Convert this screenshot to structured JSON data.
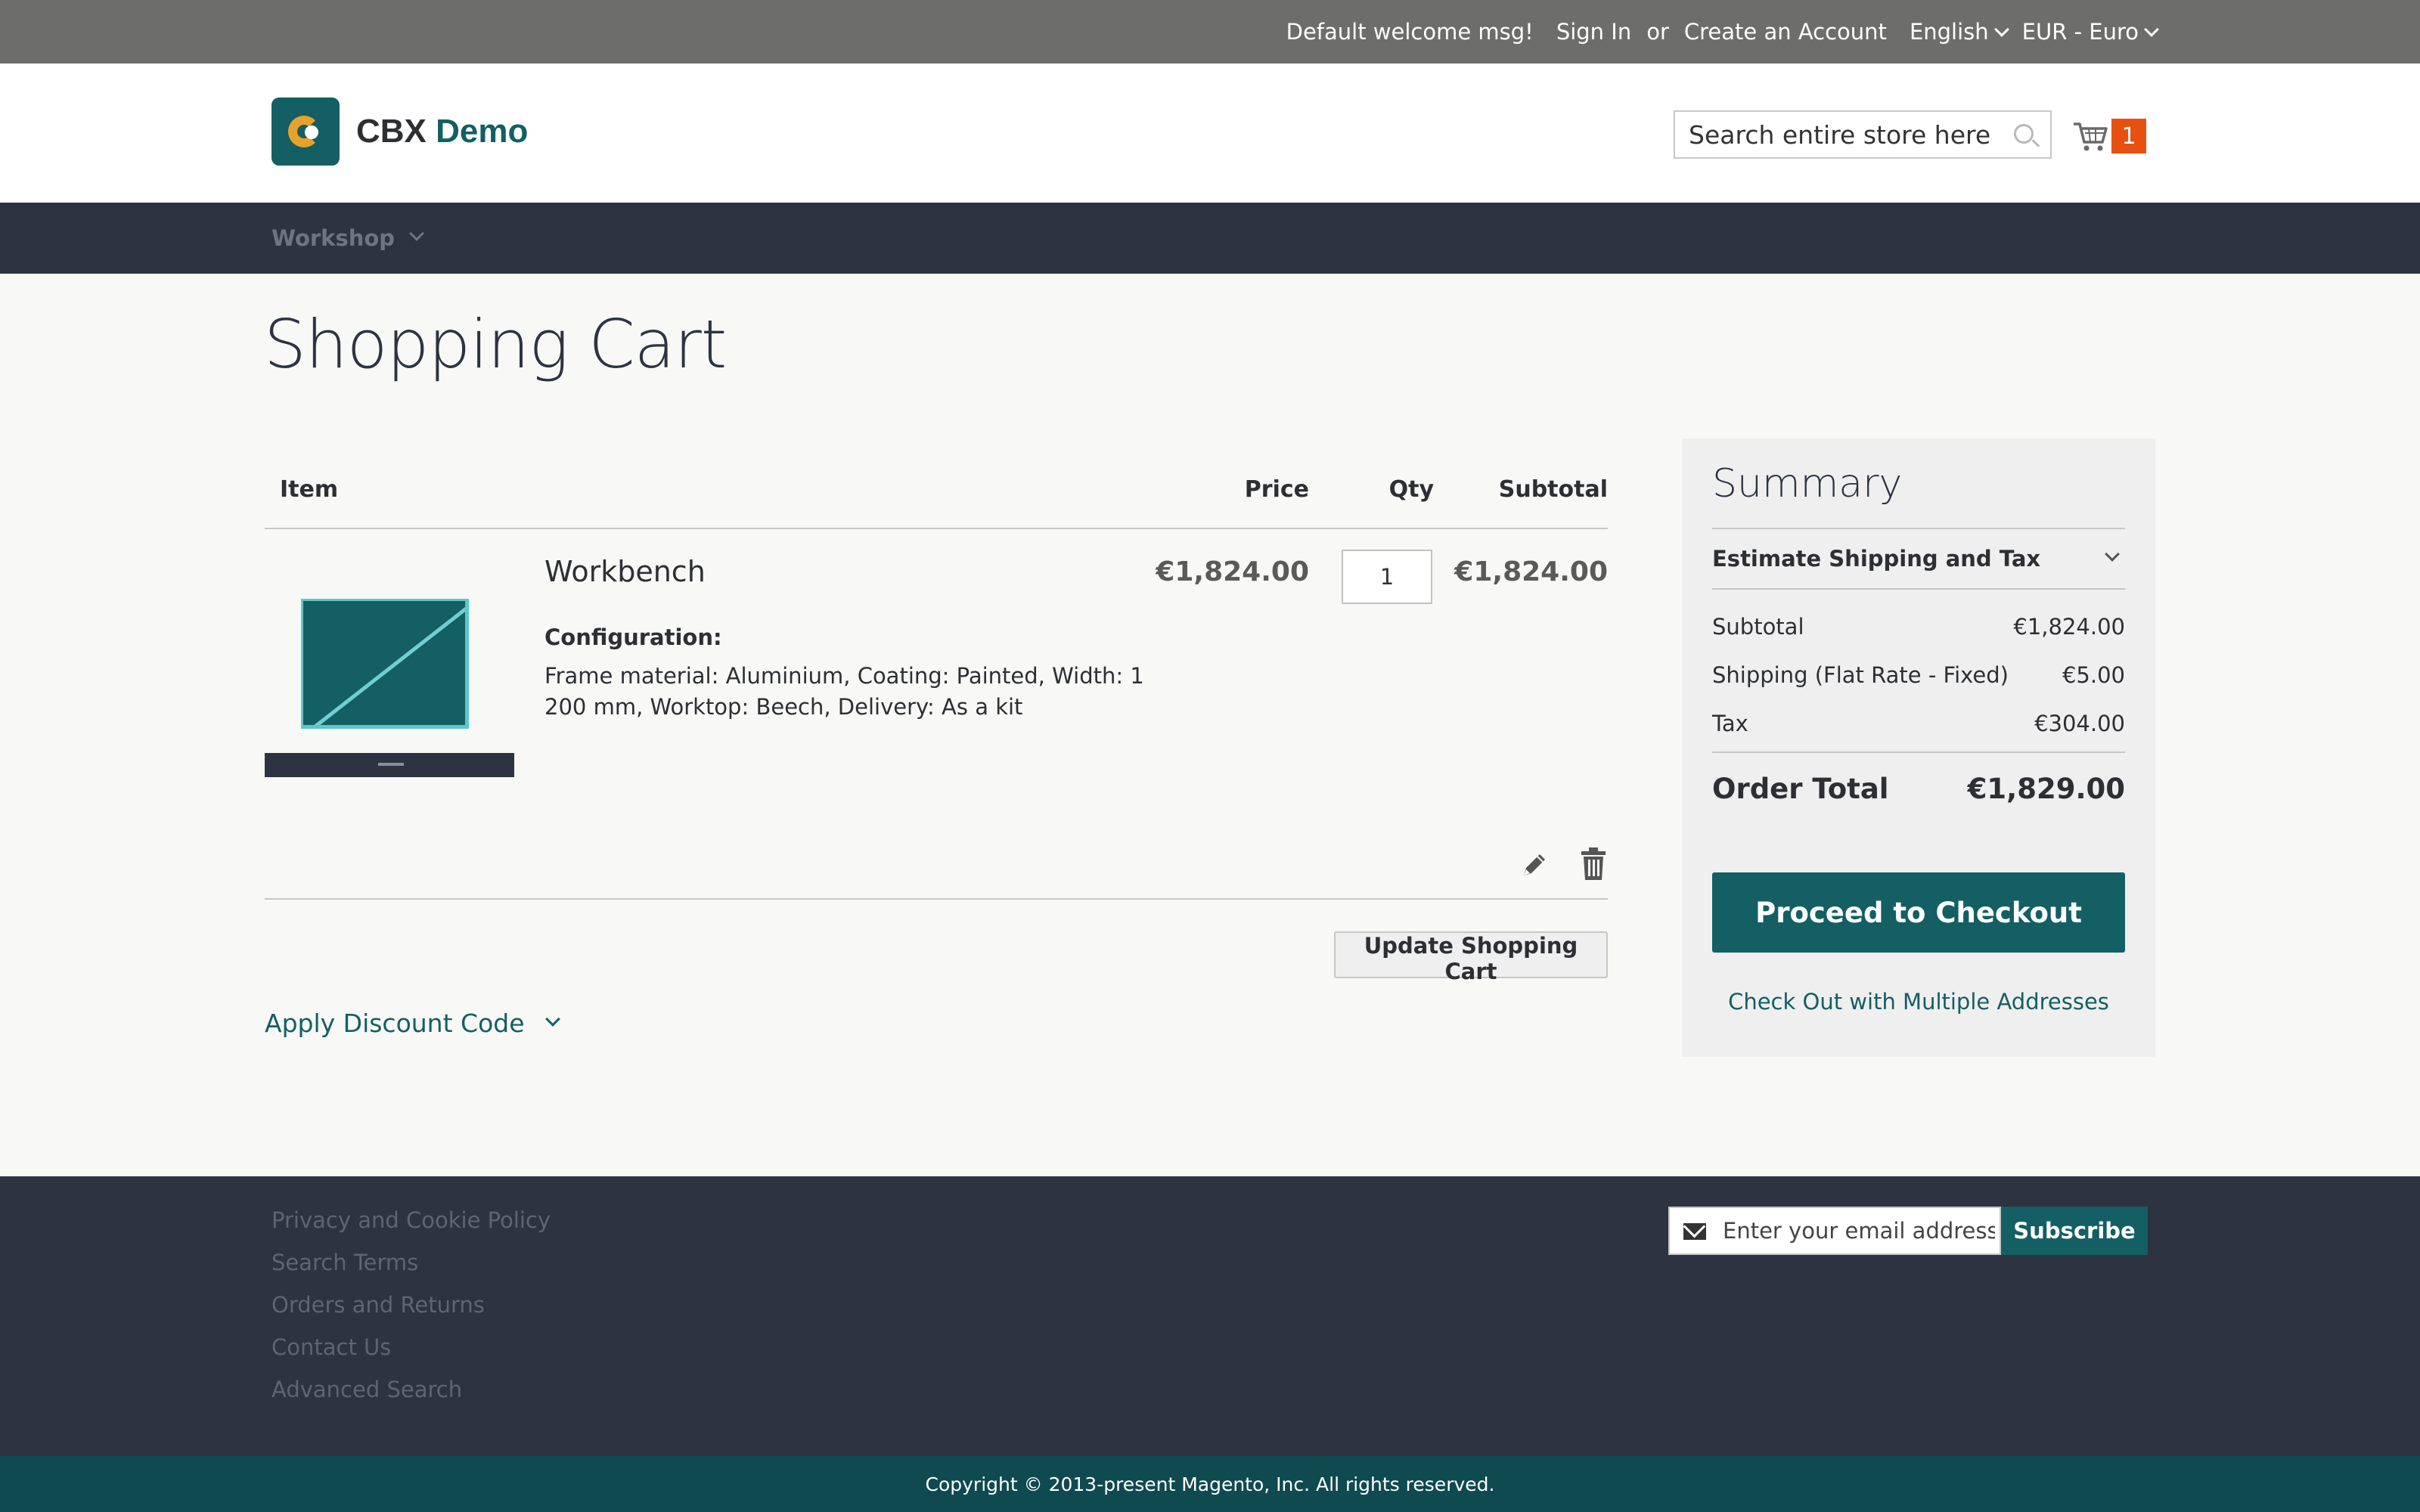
{
  "top_panel": {
    "welcome": "Default welcome msg!",
    "sign_in": "Sign In",
    "or": "or",
    "create_account": "Create an Account",
    "language": "English",
    "currency": "EUR - Euro"
  },
  "header": {
    "logo_word1": "CBX",
    "logo_word2": "Demo",
    "search_placeholder": "Search entire store here...",
    "cart_count": "1"
  },
  "nav": {
    "items": [
      {
        "label": "Workshop"
      }
    ]
  },
  "page_title": "Shopping Cart",
  "cart_table": {
    "headers": {
      "item": "Item",
      "price": "Price",
      "qty": "Qty",
      "subtotal": "Subtotal"
    },
    "items": [
      {
        "name": "Workbench",
        "config_label": "Configuration:",
        "config_value": "Frame material: Aluminium, Coating: Painted, Width: 1200 mm, Worktop: Beech, Delivery: As a kit",
        "price": "€1,824.00",
        "qty": "1",
        "subtotal": "€1,824.00"
      }
    ],
    "update_button": "Update Shopping Cart",
    "discount_label": "Apply Discount Code"
  },
  "summary": {
    "title": "Summary",
    "estimate": "Estimate Shipping and Tax",
    "rows": [
      {
        "label": "Subtotal",
        "value": "€1,824.00"
      },
      {
        "label": "Shipping (Flat Rate - Fixed)",
        "value": "€5.00"
      },
      {
        "label": "Tax",
        "value": "€304.00"
      }
    ],
    "total_label": "Order Total",
    "total_value": "€1,829.00",
    "checkout_button": "Proceed to Checkout",
    "multi_address": "Check Out with Multiple Addresses"
  },
  "footer": {
    "links": [
      "Privacy and Cookie Policy",
      "Search Terms",
      "Orders and Returns",
      "Contact Us",
      "Advanced Search"
    ],
    "newsletter_placeholder": "Enter your email address",
    "subscribe": "Subscribe",
    "copyright": "Copyright © 2013-present Magento, Inc. All rights reserved."
  },
  "icons": {
    "logo": "logo-icon",
    "search": "search-icon",
    "cart": "cart-icon",
    "edit": "pencil-icon",
    "delete": "trash-icon",
    "mail": "mail-icon"
  },
  "colors": {
    "brand": "#135f63",
    "accent": "#e8a22b",
    "cart_badge": "#e8500f",
    "nav_bg": "#2d3340"
  }
}
